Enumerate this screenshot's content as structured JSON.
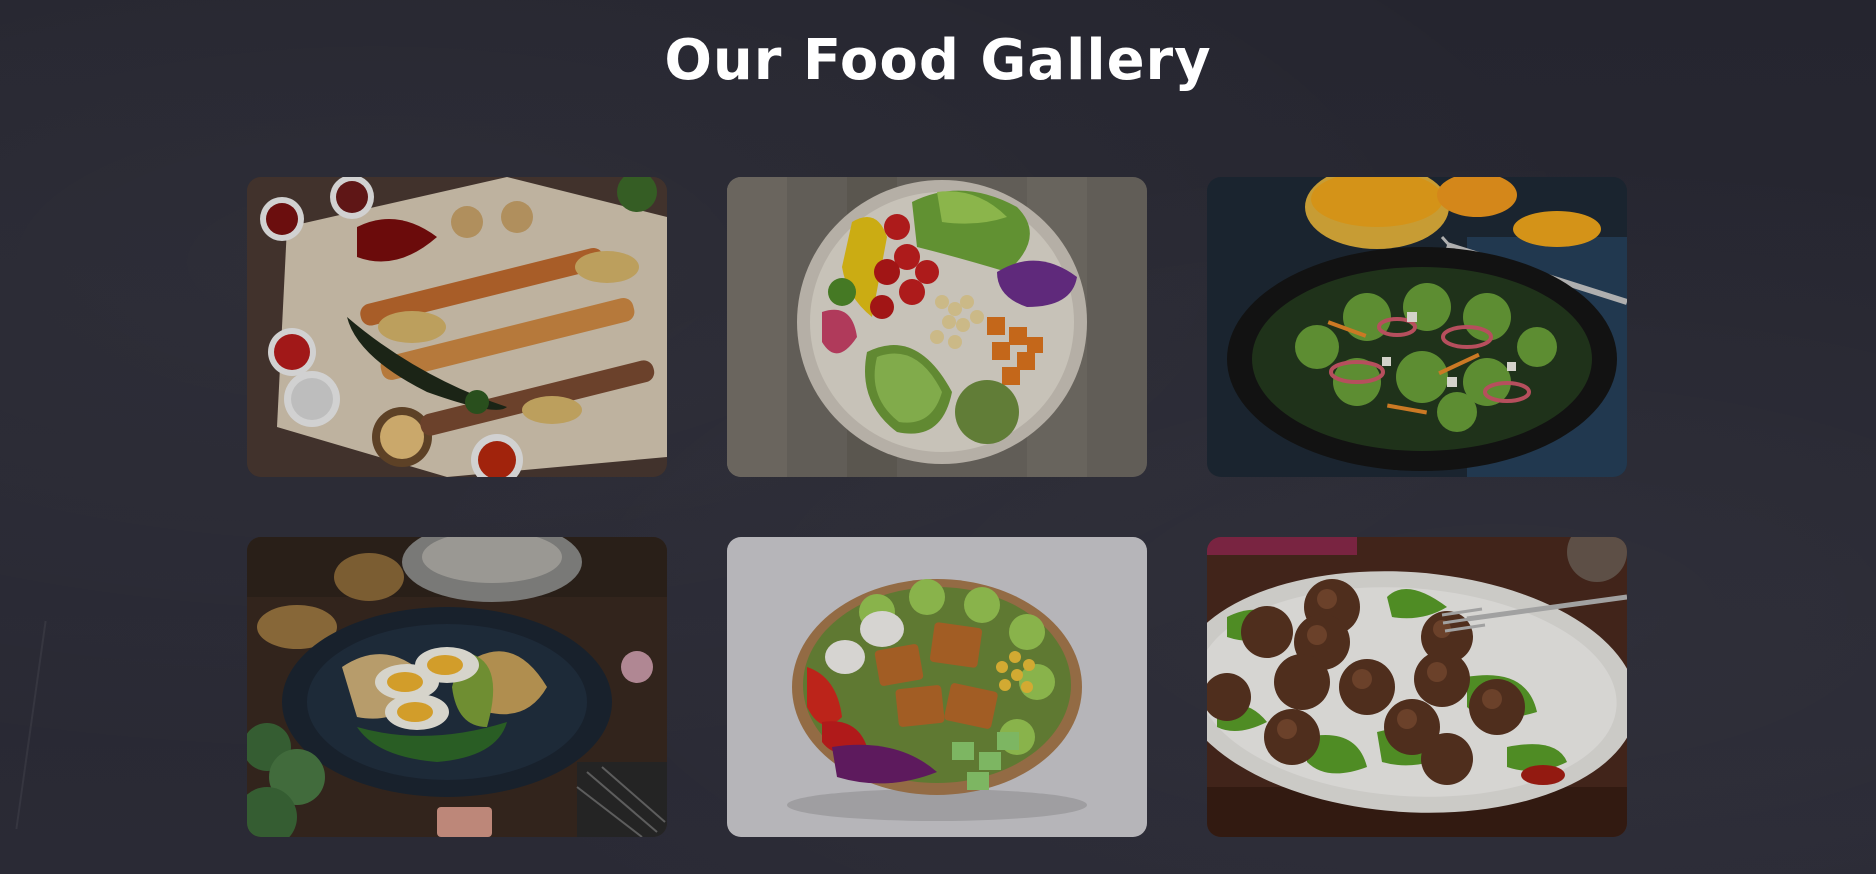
{
  "page": {
    "title": "Our Food Gallery"
  },
  "gallery": {
    "items": [
      {
        "icon": "grilled-kebab-platter-image"
      },
      {
        "icon": "vegetable-salad-bowl-image"
      },
      {
        "icon": "green-salad-plate-image"
      },
      {
        "icon": "egg-avocado-plate-image"
      },
      {
        "icon": "chicken-salad-bowl-image"
      },
      {
        "icon": "meatballs-plate-image"
      }
    ]
  },
  "colors": {
    "background": "#262630",
    "title": "#ffffff"
  }
}
